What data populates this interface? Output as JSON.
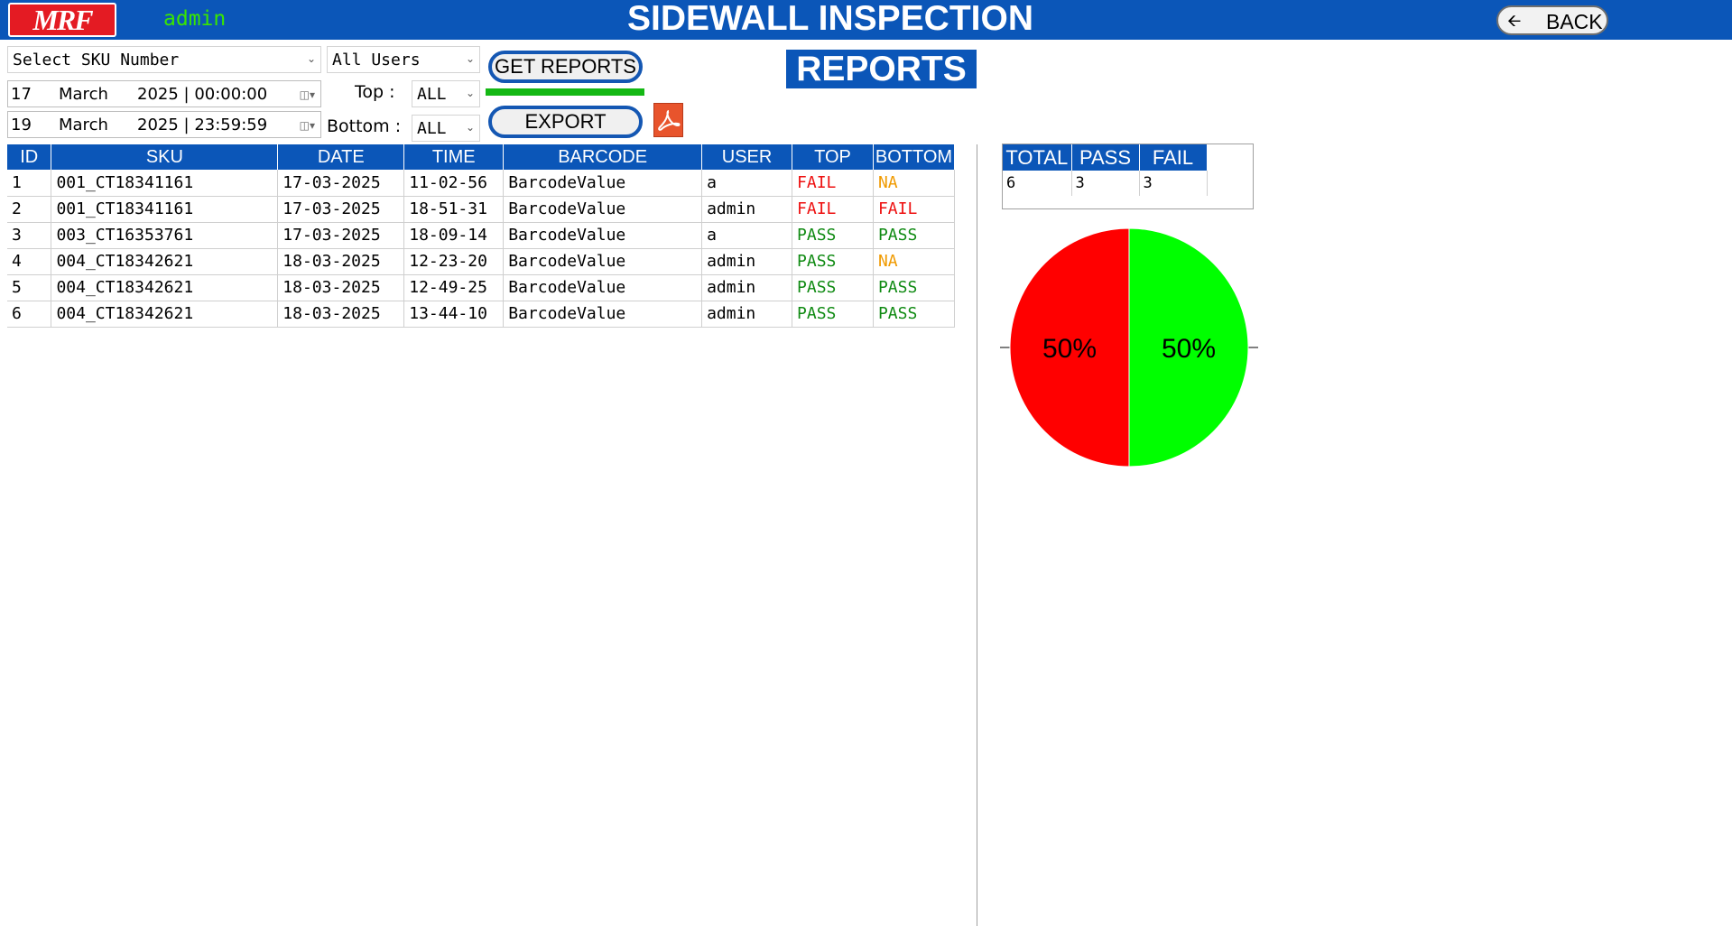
{
  "header": {
    "logo_text": "MRF",
    "user": "admin",
    "title": "SIDEWALL INSPECTION",
    "back_label": "BACK",
    "back_icon": "left-arrow-icon"
  },
  "filters": {
    "sku_placeholder": "Select SKU Number",
    "users_value": "All Users",
    "from_date": {
      "day": "17",
      "month": "March",
      "year_time": "2025 | 00:00:00"
    },
    "to_date": {
      "day": "19",
      "month": "March",
      "year_time": "2025 | 23:59:59"
    },
    "top_label": "Top :",
    "top_value": "ALL",
    "bottom_label": "Bottom :",
    "bottom_value": "ALL",
    "get_reports_label": "GET REPORTS",
    "export_label": "EXPORT",
    "progress": 1.0,
    "pdf_icon": "pdf-icon"
  },
  "page_title": "REPORTS",
  "table": {
    "columns": [
      "ID",
      "SKU",
      "DATE",
      "TIME",
      "BARCODE",
      "USER",
      "TOP",
      "BOTTOM"
    ],
    "rows": [
      [
        "1",
        "001_CT18341161",
        "17-03-2025",
        "11-02-56",
        "BarcodeValue",
        "a",
        "FAIL",
        "NA"
      ],
      [
        "2",
        "001_CT18341161",
        "17-03-2025",
        "18-51-31",
        "BarcodeValue",
        "admin",
        "FAIL",
        "FAIL"
      ],
      [
        "3",
        "003_CT16353761",
        "17-03-2025",
        "18-09-14",
        "BarcodeValue",
        "a",
        "PASS",
        "PASS"
      ],
      [
        "4",
        "004_CT18342621",
        "18-03-2025",
        "12-23-20",
        "BarcodeValue",
        "admin",
        "PASS",
        "NA"
      ],
      [
        "5",
        "004_CT18342621",
        "18-03-2025",
        "12-49-25",
        "BarcodeValue",
        "admin",
        "PASS",
        "PASS"
      ],
      [
        "6",
        "004_CT18342621",
        "18-03-2025",
        "13-44-10",
        "BarcodeValue",
        "admin",
        "PASS",
        "PASS"
      ]
    ]
  },
  "summary": {
    "columns": [
      "TOTAL",
      "PASS",
      "FAIL"
    ],
    "values": [
      "6",
      "3",
      "3"
    ]
  },
  "colors": {
    "header_blue": "#0b56b8",
    "pass_green": "#0f8a12",
    "fail_red": "#ee1111",
    "na_orange": "#f09a00",
    "pie_fail": "#ff0000",
    "pie_pass": "#00ff00"
  },
  "chart_data": {
    "type": "pie",
    "slices": [
      {
        "name": "FAIL",
        "value": 50,
        "label": "50%",
        "color": "#ff0000"
      },
      {
        "name": "PASS",
        "value": 50,
        "label": "50%",
        "color": "#00ff00"
      }
    ]
  }
}
